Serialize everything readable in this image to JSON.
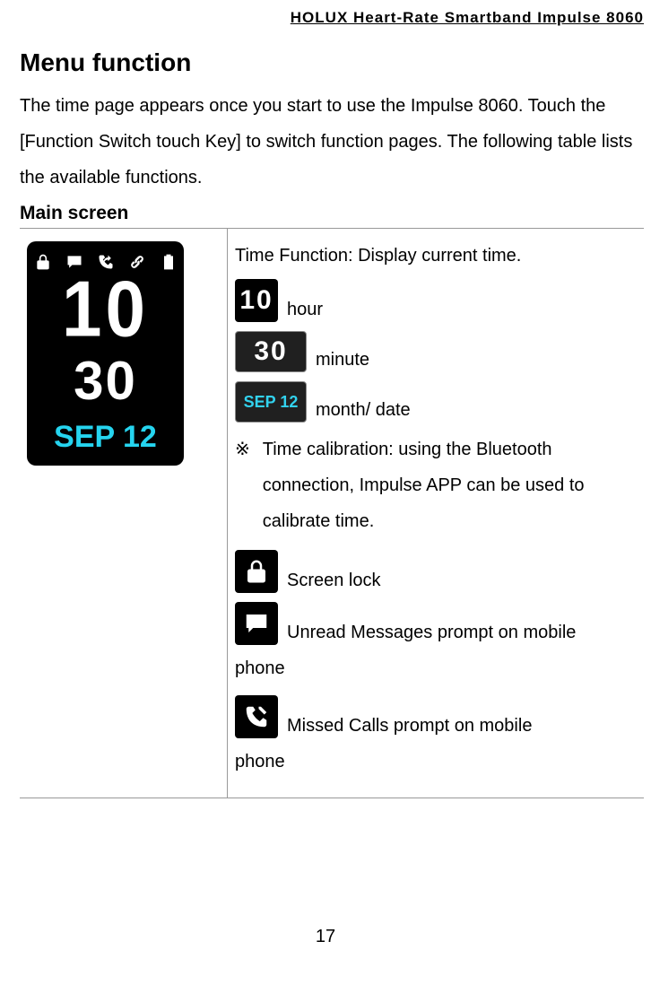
{
  "header": "HOLUX Heart-Rate Smartband Impulse 8060",
  "title": "Menu function",
  "intro": "The time page appears once you start to use the Impulse 8060. Touch the [Function Switch touch Key] to switch function pages. The following table lists the available functions.",
  "main_screen_heading": "Main screen",
  "screenshot": {
    "hour": "10",
    "minute": "30",
    "date": "SEP 12"
  },
  "rightcol": {
    "time_function": "Time Function: Display current time.",
    "hour_label": "hour",
    "hour_box": "10",
    "minute_label": "minute",
    "minute_box": "30",
    "monthdate_label": "month/ date",
    "monthdate_box": "SEP 12",
    "note_symbol": "※",
    "calibration_note": "Time calibration: using the Bluetooth connection, Impulse APP can be used to calibrate time.",
    "screen_lock": "Screen lock",
    "unread": "Unread Messages prompt on mobile",
    "unread_trail": "phone",
    "missed": "Missed Calls prompt on mobile",
    "missed_trail": "phone"
  },
  "page_number": "17"
}
